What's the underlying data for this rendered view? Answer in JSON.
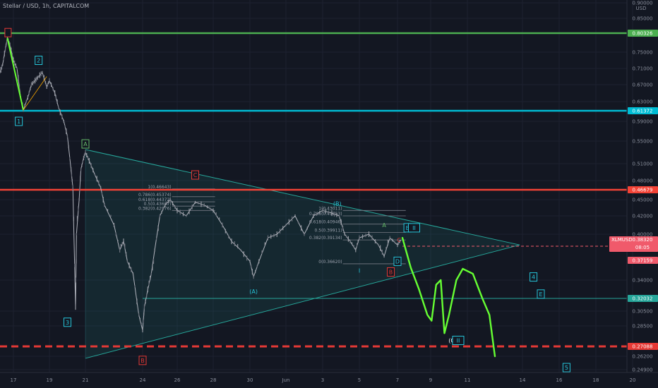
{
  "header": {
    "symbol": "Stellar / USD, 1h, CAPITALCOM",
    "currency": "USD"
  },
  "chart_data": {
    "type": "line",
    "y_range": [
      0.245,
      0.905
    ],
    "x_range": [
      16.0,
      19.35
    ],
    "x_ticks": [
      {
        "x": 17,
        "label": "17"
      },
      {
        "x": 19,
        "label": "19"
      },
      {
        "x": 21,
        "label": "21"
      },
      {
        "x": 24,
        "label": "24"
      },
      {
        "x": 26,
        "label": "26"
      },
      {
        "x": 28,
        "label": "28"
      },
      {
        "x": 30,
        "label": "30"
      },
      {
        "x": 32,
        "label": "Jun"
      },
      {
        "x": 34,
        "label": "3"
      },
      {
        "x": 36,
        "label": "5"
      },
      {
        "x": 38,
        "label": "7"
      },
      {
        "x": 40,
        "label": "9"
      },
      {
        "x": 42,
        "label": "11"
      },
      {
        "x": 44,
        "label": "14"
      },
      {
        "x": 46,
        "label": "16"
      },
      {
        "x": 48,
        "label": "18"
      },
      {
        "x": 50,
        "label": "20"
      }
    ],
    "y_ticks": [
      {
        "v": 0.9,
        "label": "0.90000"
      },
      {
        "v": 0.85,
        "label": "0.85000"
      },
      {
        "v": 0.75,
        "label": "0.75000"
      },
      {
        "v": 0.71,
        "label": "0.71000"
      },
      {
        "v": 0.67,
        "label": "0.67000"
      },
      {
        "v": 0.63,
        "label": "0.63000"
      },
      {
        "v": 0.59,
        "label": "0.59000"
      },
      {
        "v": 0.55,
        "label": "0.55000"
      },
      {
        "v": 0.51,
        "label": "0.51000"
      },
      {
        "v": 0.48,
        "label": "0.48000"
      },
      {
        "v": 0.45,
        "label": "0.45000"
      },
      {
        "v": 0.42,
        "label": "0.42000"
      },
      {
        "v": 0.4,
        "label": "0.40000"
      },
      {
        "v": 0.34,
        "label": "0.34000"
      },
      {
        "v": 0.305,
        "label": "0.30500"
      },
      {
        "v": 0.285,
        "label": "0.28500"
      },
      {
        "v": 0.262,
        "label": "0.26200"
      },
      {
        "v": 0.249,
        "label": "0.24900"
      }
    ],
    "price_path": [
      [
        16.0,
        0.7
      ],
      [
        16.2,
        0.72
      ],
      [
        16.4,
        0.76
      ],
      [
        16.55,
        0.79
      ],
      [
        16.75,
        0.77
      ],
      [
        17.0,
        0.73
      ],
      [
        17.2,
        0.71
      ],
      [
        17.4,
        0.64
      ],
      [
        17.55,
        0.615
      ],
      [
        17.8,
        0.64
      ],
      [
        18.0,
        0.67
      ],
      [
        18.2,
        0.68
      ],
      [
        18.4,
        0.69
      ],
      [
        18.6,
        0.7
      ],
      [
        18.75,
        0.68
      ],
      [
        18.85,
        0.665
      ],
      [
        19.0,
        0.68
      ],
      [
        19.3,
        0.65
      ],
      [
        19.5,
        0.62
      ],
      [
        19.8,
        0.59
      ],
      [
        20.0,
        0.56
      ],
      [
        20.2,
        0.5
      ],
      [
        20.3,
        0.47
      ],
      [
        20.45,
        0.31
      ],
      [
        20.5,
        0.4
      ],
      [
        20.65,
        0.45
      ],
      [
        20.75,
        0.5
      ],
      [
        20.9,
        0.52
      ],
      [
        21.0,
        0.53
      ],
      [
        21.2,
        0.515
      ],
      [
        21.5,
        0.49
      ],
      [
        21.8,
        0.47
      ],
      [
        22.0,
        0.44
      ],
      [
        22.5,
        0.41
      ],
      [
        22.8,
        0.38
      ],
      [
        23.0,
        0.39
      ],
      [
        23.2,
        0.37
      ],
      [
        23.5,
        0.35
      ],
      [
        23.8,
        0.3
      ],
      [
        24.0,
        0.282
      ],
      [
        24.1,
        0.31
      ],
      [
        24.3,
        0.33
      ],
      [
        24.5,
        0.35
      ],
      [
        24.7,
        0.38
      ],
      [
        25.0,
        0.42
      ],
      [
        25.3,
        0.44
      ],
      [
        25.6,
        0.45
      ],
      [
        26.0,
        0.43
      ],
      [
        26.5,
        0.42
      ],
      [
        27.0,
        0.445
      ],
      [
        27.5,
        0.44
      ],
      [
        28.0,
        0.43
      ],
      [
        28.5,
        0.41
      ],
      [
        29.0,
        0.39
      ],
      [
        29.5,
        0.38
      ],
      [
        30.0,
        0.37
      ],
      [
        30.2,
        0.345
      ],
      [
        30.5,
        0.37
      ],
      [
        31.0,
        0.395
      ],
      [
        31.5,
        0.4
      ],
      [
        32.0,
        0.41
      ],
      [
        32.5,
        0.42
      ],
      [
        33.0,
        0.4
      ],
      [
        33.5,
        0.42
      ],
      [
        34.0,
        0.43
      ],
      [
        34.5,
        0.425
      ],
      [
        34.9,
        0.42
      ],
      [
        35.2,
        0.4
      ],
      [
        35.5,
        0.39
      ],
      [
        35.8,
        0.38
      ],
      [
        36.0,
        0.395
      ],
      [
        36.5,
        0.4
      ],
      [
        37.0,
        0.385
      ],
      [
        37.3,
        0.375
      ],
      [
        37.6,
        0.395
      ],
      [
        38.0,
        0.385
      ],
      [
        38.2,
        0.392
      ]
    ],
    "horizontal_levels": [
      {
        "v": 0.80326,
        "label": "0.80326",
        "color": "#4caf50"
      },
      {
        "v": 0.61372,
        "label": "0.61372",
        "color": "#00bcd4"
      },
      {
        "v": 0.46679,
        "label": "0.46679",
        "color": "#f44336"
      },
      {
        "v": 0.32032,
        "label": "0.32032",
        "color": "#26a69a"
      },
      {
        "v": 0.27088,
        "label": "0.27088",
        "color": "#e53935"
      }
    ],
    "current_price": {
      "v": 0.3832,
      "label": "0.38320",
      "symbol": "XLMUSD",
      "countdown": "08:05",
      "color": "#f05a6b"
    },
    "marker_price": {
      "v": 0.37159,
      "label": "0.37159",
      "color": "#f05a6b"
    },
    "triangle": {
      "upper": [
        [
          21.0,
          0.535
        ],
        [
          43.9,
          0.385
        ]
      ],
      "lower": [
        [
          21.0,
          0.26
        ],
        [
          43.9,
          0.385
        ]
      ]
    },
    "projection": [
      [
        38.3,
        0.395
      ],
      [
        38.8,
        0.36
      ],
      [
        39.3,
        0.33
      ],
      [
        39.8,
        0.3
      ],
      [
        40.05,
        0.292
      ],
      [
        40.3,
        0.335
      ],
      [
        40.55,
        0.34
      ],
      [
        40.75,
        0.28
      ],
      [
        41.0,
        0.3
      ],
      [
        41.4,
        0.34
      ],
      [
        41.75,
        0.358
      ],
      [
        42.2,
        0.35
      ],
      [
        42.55,
        0.32
      ],
      [
        42.8,
        0.3
      ],
      [
        43.0,
        0.262
      ]
    ],
    "fib_sets": [
      {
        "x1": 25.7,
        "x2": 28.1,
        "levels": [
          {
            "v": 0.468,
            "label": "1(0.46643)"
          },
          {
            "v": 0.455,
            "label": "0.786(0.45374)"
          },
          {
            "v": 0.446,
            "label": "0.618(0.44372)"
          },
          {
            "v": 0.438,
            "label": "0.5(0.43677)"
          },
          {
            "v": 0.43,
            "label": "0.382(0.42976)"
          }
        ]
      },
      {
        "x1": 35.1,
        "x2": 38.5,
        "levels": [
          {
            "v": 0.43,
            "label": "1(0.43011)"
          },
          {
            "v": 0.42,
            "label": "0.786(0.41853)"
          },
          {
            "v": 0.411,
            "label": "0.618(0.40946)"
          },
          {
            "v": 0.402,
            "label": "0.5(0.39911)"
          },
          {
            "v": 0.392,
            "label": "0.382(0.39134)"
          },
          {
            "v": 0.366,
            "label": "0(0.36620)"
          }
        ]
      }
    ],
    "wave_labels": [
      {
        "x": 16.6,
        "v": 0.805,
        "text": "",
        "color": "#e53935",
        "boxed": true
      },
      {
        "x": 17.3,
        "v": 0.59,
        "text": "1",
        "color": "#26c6da",
        "boxed": true
      },
      {
        "x": 18.4,
        "v": 0.73,
        "text": "2",
        "color": "#26c6da",
        "boxed": true
      },
      {
        "x": 20.0,
        "v": 0.29,
        "text": "3",
        "color": "#26c6da",
        "boxed": true
      },
      {
        "x": 21.0,
        "v": 0.545,
        "text": "A",
        "color": "#66bb6a",
        "boxed": true
      },
      {
        "x": 24.0,
        "v": 0.258,
        "text": "B",
        "color": "#e53935",
        "boxed": true
      },
      {
        "x": 27.0,
        "v": 0.49,
        "text": "C",
        "color": "#e53935",
        "boxed": true
      },
      {
        "x": 30.2,
        "v": 0.328,
        "text": "(A)",
        "color": "#26c6da",
        "boxed": false
      },
      {
        "x": 34.8,
        "v": 0.443,
        "text": "(B)",
        "color": "#26c6da",
        "boxed": false
      },
      {
        "x": 36.0,
        "v": 0.355,
        "text": "I",
        "color": "#26c6da",
        "boxed": false
      },
      {
        "x": 37.3,
        "v": 0.41,
        "text": "A",
        "color": "#66bb6a",
        "boxed": false
      },
      {
        "x": 37.65,
        "v": 0.353,
        "text": "B",
        "color": "#e53935",
        "boxed": true
      },
      {
        "x": 38.1,
        "v": 0.392,
        "text": "C",
        "color": "#e53935",
        "boxed": false
      },
      {
        "x": 38.0,
        "v": 0.37,
        "text": "D",
        "color": "#26c6da",
        "boxed": true
      },
      {
        "x": 38.6,
        "v": 0.407,
        "text": "E",
        "color": "#26c6da",
        "boxed": true
      },
      {
        "x": 39.0,
        "v": 0.407,
        "text": "II",
        "color": "#26c6da",
        "boxed": true
      },
      {
        "x": 41.2,
        "v": 0.275,
        "text": "(C)",
        "color": "#ffffff",
        "boxed": false
      },
      {
        "x": 41.5,
        "v": 0.275,
        "text": "II",
        "color": "#26c6da",
        "boxed": true
      },
      {
        "x": 44.6,
        "v": 0.345,
        "text": "4",
        "color": "#26c6da",
        "boxed": true
      },
      {
        "x": 45.0,
        "v": 0.325,
        "text": "E",
        "color": "#26c6da",
        "boxed": true
      },
      {
        "x": 46.4,
        "v": 0.251,
        "text": "5",
        "color": "#26c6da",
        "boxed": true
      }
    ]
  }
}
